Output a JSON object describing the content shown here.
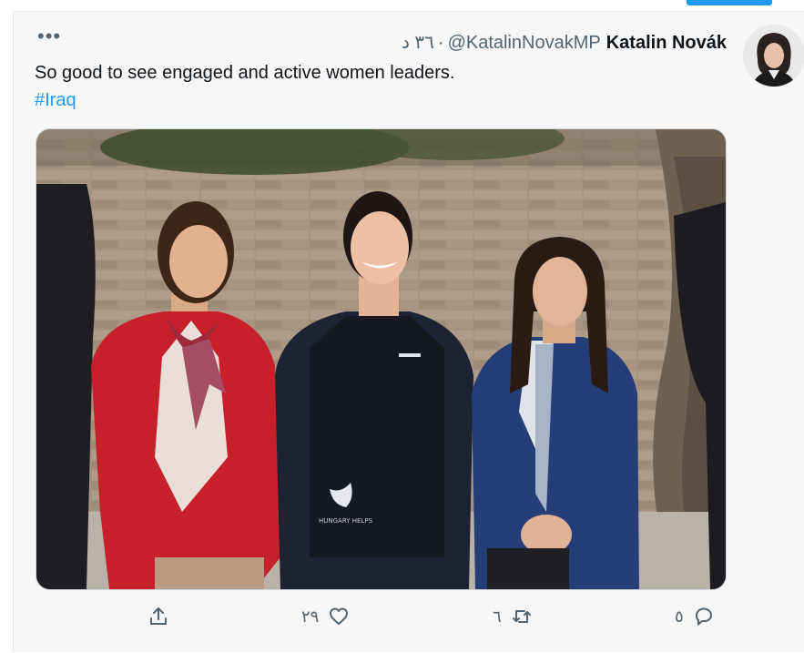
{
  "tweet": {
    "author_name": "Katalin Novák",
    "handle": "@KatalinNovakMP",
    "timestamp": "٣٦ د",
    "text": "So good to see engaged and active women leaders.",
    "hashtag": "#Iraq",
    "more_label": "•••",
    "vest_logo_text": "HUNGARY HELPS"
  },
  "actions": {
    "share_icon": "share-icon",
    "like_icon": "heart-icon",
    "like_count": "٢٩",
    "retweet_icon": "retweet-icon",
    "retweet_count": "٦",
    "reply_icon": "reply-icon",
    "reply_count": "٥"
  },
  "colors": {
    "accent": "#1d9bf0",
    "text": "#0f1419",
    "secondary": "#536471"
  }
}
